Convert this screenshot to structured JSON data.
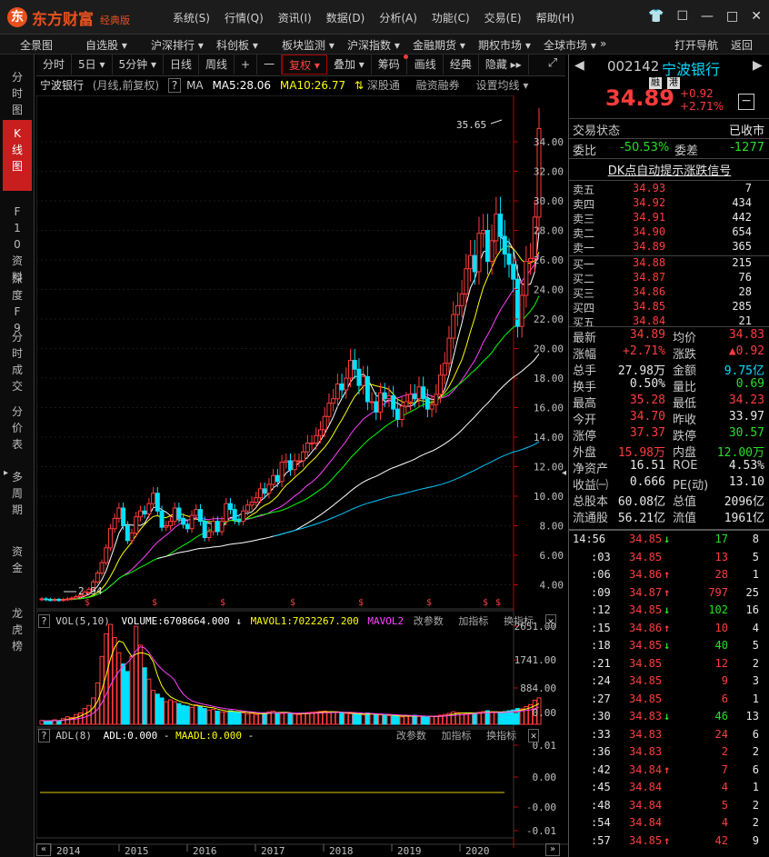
{
  "app": {
    "logo_char": "东",
    "name": "东方财富",
    "edition": "经典版"
  },
  "menu": [
    "系统(S)",
    "行情(Q)",
    "资讯(I)",
    "数据(D)",
    "分析(A)",
    "功能(C)",
    "交易(E)",
    "帮助(H)"
  ],
  "navbar": [
    "全景图",
    "自选股 ▾",
    "沪深排行 ▾",
    "科创板 ▾",
    "板块监测 ▾",
    "沪深指数 ▾",
    "金融期货 ▾",
    "期权市场 ▾",
    "全球市场 ▾",
    "»",
    "打开导航",
    "返回"
  ],
  "left_tabs": [
    "分时图",
    "K线图",
    "F10资料",
    "深度F9",
    "分时成交",
    "分价表",
    "多周期",
    "资金",
    "龙虎榜"
  ],
  "toolbar": [
    "分时",
    "5日 ▾",
    "5分钟 ▾",
    "日线",
    "周线",
    "+",
    "一",
    "复权 ▾",
    "叠加 ▾",
    "筹码",
    "画线",
    "经典",
    "隐藏 ▸▸"
  ],
  "chart_header": {
    "name": "宁波银行",
    "period": "(月线,前复权)",
    "q": "?",
    "ma": "MA",
    "ma5": "MA5:28.06",
    "ma10": "MA10:26.77",
    "sgt": "深股通",
    "rzrq": "融资融券",
    "setma": "设置均线"
  },
  "price_axis": [
    "34.00",
    "32.00",
    "30.00",
    "28.00",
    "26.00",
    "24.00",
    "22.00",
    "20.00",
    "18.00",
    "16.00",
    "14.00",
    "12.00",
    "10.00",
    "8.00",
    "6.00",
    "4.00"
  ],
  "high_label": "35.65",
  "low_label": "2.94",
  "vol_panel": {
    "label": "VOL(5,10)",
    "volume": "VOLUME:6708664.000",
    "mavol1": "MAVOL1:7022267.200",
    "mavol2": "MAVOL2",
    "btns": [
      "改参数",
      "加指标",
      "换指标"
    ],
    "axis": [
      "2651.00",
      "1741.00",
      "884.00",
      "0.00"
    ]
  },
  "adl_panel": {
    "label": "ADL(8)",
    "adl": "ADL:0.000",
    "maadl": "MAADL:0.000",
    "btns": [
      "改参数",
      "加指标",
      "换指标"
    ],
    "axis": [
      "0.01",
      "0.00",
      "-0.00",
      "-0.01"
    ]
  },
  "years": [
    "2014",
    "2015",
    "2016",
    "2017",
    "2018",
    "2019",
    "2020"
  ],
  "quote": {
    "code": "002142",
    "name": "宁波银行",
    "price": "34.89",
    "change": "+0.92",
    "pct": "+2.71%",
    "tag1": "融",
    "tag2": "港",
    "status_label": "交易状态",
    "status": "已收市",
    "wb_label": "委比",
    "wb": "-50.53%",
    "wc_label": "委差",
    "wc": "-1277",
    "dk": "DK点自动提示涨跌信号",
    "asks": [
      [
        "卖五",
        "34.93",
        "7"
      ],
      [
        "卖四",
        "34.92",
        "434"
      ],
      [
        "卖三",
        "34.91",
        "442"
      ],
      [
        "卖二",
        "34.90",
        "654"
      ],
      [
        "卖一",
        "34.89",
        "365"
      ]
    ],
    "bids": [
      [
        "买一",
        "34.88",
        "215"
      ],
      [
        "买二",
        "34.87",
        "76"
      ],
      [
        "买三",
        "34.86",
        "28"
      ],
      [
        "买四",
        "34.85",
        "285"
      ],
      [
        "买五",
        "34.84",
        "21"
      ]
    ],
    "stats": [
      [
        "最新",
        "34.89",
        "均价",
        "34.83"
      ],
      [
        "涨幅",
        "+2.71%",
        "涨跌",
        "▲0.92"
      ],
      [
        "总手",
        "27.98万",
        "金额",
        "9.75亿"
      ],
      [
        "换手",
        "0.50%",
        "量比",
        "0.69"
      ],
      [
        "最高",
        "35.28",
        "最低",
        "34.23"
      ],
      [
        "今开",
        "34.70",
        "昨收",
        "33.97"
      ],
      [
        "涨停",
        "37.37",
        "跌停",
        "30.57"
      ],
      [
        "外盘",
        "15.98万",
        "内盘",
        "12.00万"
      ],
      [
        "净资产",
        "16.51",
        "ROE",
        "4.53%"
      ],
      [
        "收益㈠",
        "0.666",
        "PE(动)",
        "13.10"
      ],
      [
        "总股本",
        "60.08亿",
        "总值",
        "2096亿"
      ],
      [
        "流通股",
        "56.21亿",
        "流值",
        "1961亿"
      ]
    ]
  },
  "ticks": [
    [
      "14:56",
      "34.85",
      "↓",
      "17",
      "8"
    ],
    [
      ":03",
      "34.85",
      "",
      "13",
      "5"
    ],
    [
      ":06",
      "34.86",
      "↑",
      "28",
      "1"
    ],
    [
      ":09",
      "34.87",
      "↑",
      "797",
      "25"
    ],
    [
      ":12",
      "34.85",
      "↓",
      "102",
      "16"
    ],
    [
      ":15",
      "34.86",
      "↑",
      "10",
      "4"
    ],
    [
      ":18",
      "34.85",
      "↓",
      "40",
      "5"
    ],
    [
      ":21",
      "34.85",
      "",
      "12",
      "2"
    ],
    [
      ":24",
      "34.85",
      "",
      "9",
      "3"
    ],
    [
      ":27",
      "34.85",
      "",
      "6",
      "1"
    ],
    [
      ":30",
      "34.83",
      "↓",
      "46",
      "13"
    ],
    [
      ":33",
      "34.83",
      "",
      "24",
      "6"
    ],
    [
      ":36",
      "34.83",
      "",
      "2",
      "2"
    ],
    [
      ":42",
      "34.84",
      "↑",
      "7",
      "6"
    ],
    [
      ":45",
      "34.84",
      "",
      "4",
      "1"
    ],
    [
      ":48",
      "34.84",
      "",
      "5",
      "2"
    ],
    [
      ":54",
      "34.84",
      "",
      "4",
      "2"
    ],
    [
      ":57",
      "34.85",
      "↑",
      "42",
      "9"
    ]
  ],
  "colors": {
    "up": "#ff3c3c",
    "down": "#00e0ff",
    "ma5": "#ffffff",
    "ma10": "#ffff00",
    "ma20": "#ff40ff",
    "ma30": "#00ff00",
    "ma60": "#ffffff",
    "ma120": "#00c8ff"
  }
}
